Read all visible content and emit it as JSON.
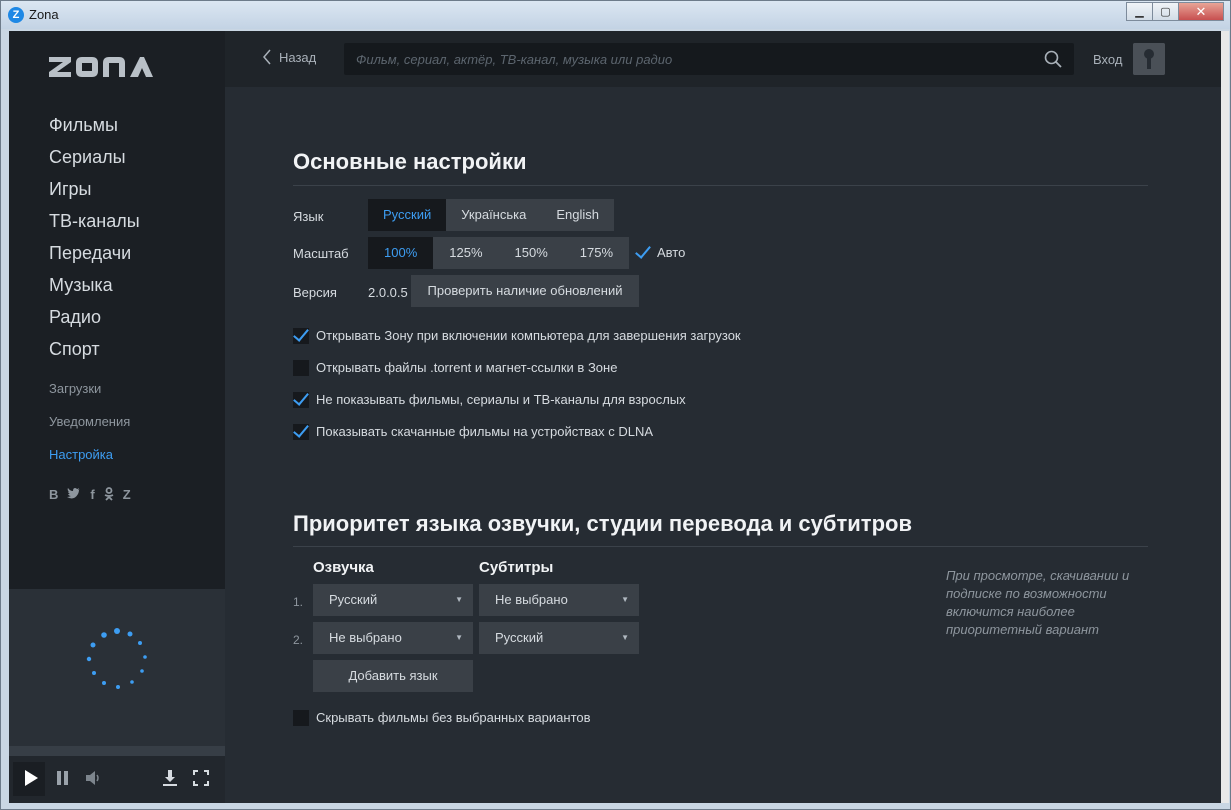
{
  "window": {
    "title": "Zona",
    "app_icon": "Z"
  },
  "sidebar": {
    "logo": "ZONA",
    "main_items": [
      "Фильмы",
      "Сериалы",
      "Игры",
      "ТВ-каналы",
      "Передачи",
      "Музыка",
      "Радио",
      "Спорт"
    ],
    "sub_items": [
      "Загрузки",
      "Уведомления",
      "Настройка"
    ],
    "active_sub": "Настройка",
    "socials": [
      "B",
      "twitter",
      "f",
      "ok",
      "zona"
    ]
  },
  "topbar": {
    "back_label": "Назад",
    "search_placeholder": "Фильм, сериал, актёр, ТВ-канал, музыка или радио",
    "login_label": "Вход"
  },
  "general": {
    "title": "Основные настройки",
    "language": {
      "label": "Язык",
      "options": [
        "Русский",
        "Українська",
        "English"
      ],
      "selected": "Русский"
    },
    "scale": {
      "label": "Масштаб",
      "options": [
        "100%",
        "125%",
        "150%",
        "175%"
      ],
      "selected": "100%",
      "auto_label": "Авто",
      "auto_checked": true
    },
    "version": {
      "label": "Версия",
      "value": "2.0.0.5",
      "check_button": "Проверить наличие обновлений"
    },
    "checkboxes": [
      {
        "label": "Открывать Зону при включении компьютера для завершения загрузок",
        "checked": true
      },
      {
        "label": "Открывать файлы .torrent и магнет-ссылки в Зоне",
        "checked": false
      },
      {
        "label": "Не показывать фильмы, сериалы и ТВ-каналы для взрослых",
        "checked": true
      },
      {
        "label": "Показывать скачанные фильмы на устройствах с DLNA",
        "checked": true
      }
    ]
  },
  "priority": {
    "title": "Приоритет языка озвучки, студии перевода и субтитров",
    "voice_header": "Озвучка",
    "subs_header": "Субтитры",
    "rows": [
      {
        "num": "1.",
        "voice": "Русский",
        "subs": "Не выбрано"
      },
      {
        "num": "2.",
        "voice": "Не выбрано",
        "subs": "Русский"
      }
    ],
    "add_button": "Добавить язык",
    "hide_label": "Скрывать фильмы без выбранных вариантов",
    "hide_checked": false,
    "hint": "При просмотре, скачивании и подписке по возможности включится наиболее приоритетный вариант"
  },
  "colors": {
    "accent": "#3d9df2",
    "sidebar_bg": "#1b1f24",
    "main_bg": "#262c33"
  }
}
